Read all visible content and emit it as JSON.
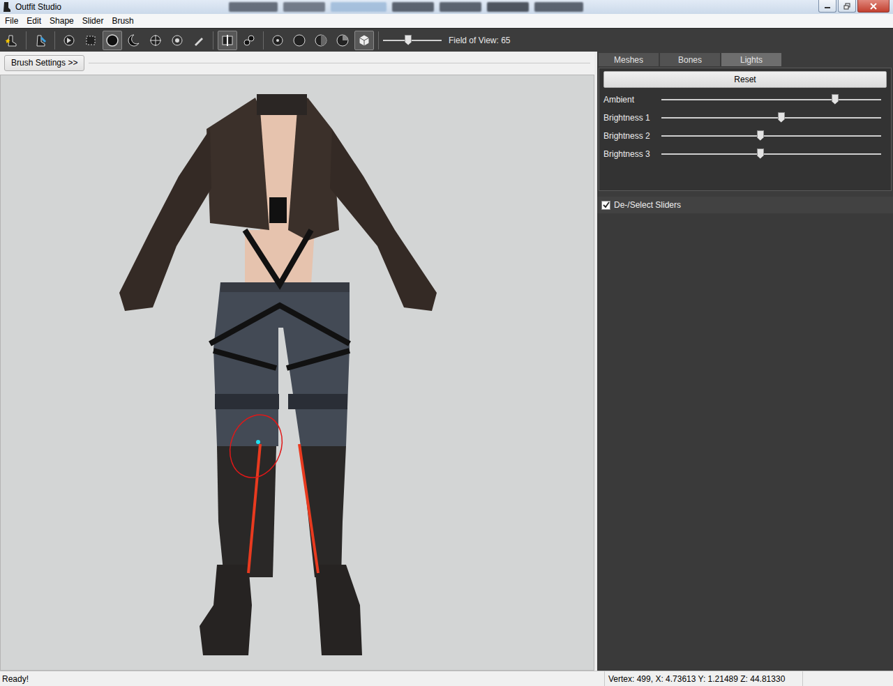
{
  "window": {
    "title": "Outfit Studio"
  },
  "menu": [
    "File",
    "Edit",
    "Shape",
    "Slider",
    "Brush"
  ],
  "toolbar": {
    "tool_groups": [
      [
        {
          "selected": false
        }
      ],
      [
        {
          "selected": false
        }
      ],
      [
        {
          "selected": false
        },
        {
          "selected": false
        },
        {
          "selected": true
        },
        {
          "selected": false
        },
        {
          "selected": false
        },
        {
          "selected": false
        },
        {
          "selected": false
        }
      ],
      [
        {
          "selected": true
        },
        {
          "selected": false
        }
      ],
      [
        {
          "selected": false
        },
        {
          "selected": false
        },
        {
          "selected": false
        },
        {
          "selected": false
        },
        {
          "selected": true
        }
      ]
    ],
    "fov": {
      "label": "Field of View: 65",
      "level": 0.43
    }
  },
  "brush_settings": {
    "label": "Brush Settings >>"
  },
  "viewport": {
    "brush_visible": true
  },
  "panel": {
    "tabs": [
      {
        "label": "Meshes",
        "selected": false
      },
      {
        "label": "Bones",
        "selected": false
      },
      {
        "label": "Lights",
        "selected": true
      }
    ],
    "reset": "Reset",
    "lights": [
      {
        "label": "Ambient",
        "level": 0.79
      },
      {
        "label": "Brightness 1",
        "level": 0.545
      },
      {
        "label": "Brightness 2",
        "level": 0.45
      },
      {
        "label": "Brightness 3",
        "level": 0.45
      }
    ]
  },
  "sliders_toggle": {
    "label": "De-/Select Sliders",
    "checked": true
  },
  "status_bar": {
    "message": "Ready!",
    "vertex": "Vertex: 499, X: 4.73613 Y: 1.21489 Z: 44.81330"
  }
}
